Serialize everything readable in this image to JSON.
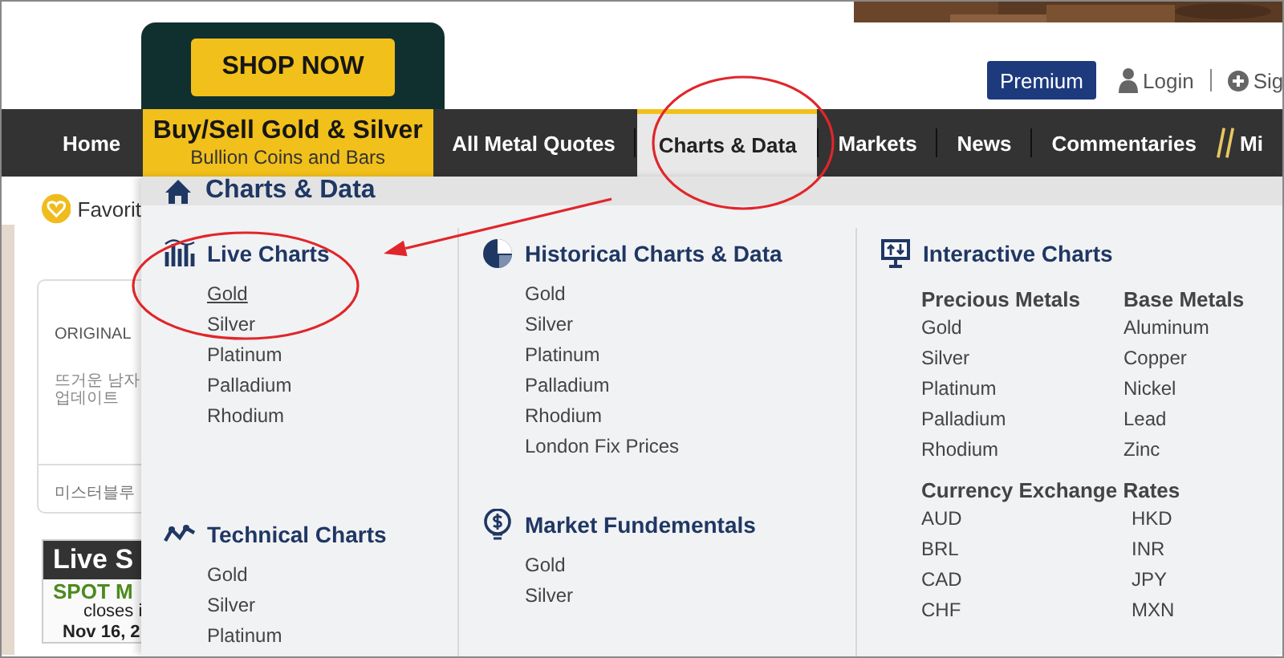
{
  "header": {
    "shop_button": "SHOP NOW",
    "premium_button": "Premium",
    "login_link": "Login",
    "signup_link": "Sig"
  },
  "nav": [
    {
      "label": "Home",
      "kind": "plain",
      "selected": false
    },
    {
      "label": "Buy/Sell Gold & Silver",
      "sublabel": "Bullion Coins and Bars",
      "kind": "promo",
      "selected": false
    },
    {
      "label": "All Metal Quotes",
      "kind": "plain",
      "selected": false
    },
    {
      "label": "Charts & Data",
      "kind": "plain",
      "selected": true
    },
    {
      "label": "Markets",
      "kind": "plain",
      "selected": false
    },
    {
      "label": "News",
      "kind": "plain",
      "selected": false
    },
    {
      "label": "Commentaries",
      "kind": "plain",
      "selected": false
    },
    {
      "label": "Mi",
      "kind": "featured",
      "selected": false
    }
  ],
  "page_behind": {
    "favorites_label": "Favorit",
    "card": {
      "lines": [
        "ORIGINAL",
        "뜨거운 남자",
        "업데이트"
      ],
      "footer": "미스터블루"
    },
    "live_box": {
      "title": "Live S",
      "spot_label": "SPOT M",
      "closes_text": "closes i",
      "date": "Nov 16, 2"
    }
  },
  "menu": {
    "title": "Charts & Data",
    "columns": [
      {
        "sections": [
          {
            "title": "Live Charts",
            "items": [
              {
                "label": "Gold",
                "hovered": true
              },
              {
                "label": "Silver",
                "hovered": false
              },
              {
                "label": "Platinum",
                "hovered": false
              },
              {
                "label": "Palladium",
                "hovered": false
              },
              {
                "label": "Rhodium",
                "hovered": false
              }
            ]
          },
          {
            "title": "Technical Charts",
            "items": [
              "Gold",
              "Silver",
              "Platinum"
            ]
          }
        ]
      },
      {
        "sections": [
          {
            "title": "Historical Charts & Data",
            "items": [
              "Gold",
              "Silver",
              "Platinum",
              "Palladium",
              "Rhodium",
              "London Fix Prices"
            ]
          },
          {
            "title": "Market Fundementals",
            "items": [
              "Gold",
              "Silver"
            ]
          }
        ]
      },
      {
        "sections": [
          {
            "title": "Interactive Charts",
            "groups": [
              {
                "heading": "Precious Metals",
                "items": [
                  "Gold",
                  "Silver",
                  "Platinum",
                  "Palladium",
                  "Rhodium"
                ]
              },
              {
                "heading": "Base Metals",
                "items": [
                  "Aluminum",
                  "Copper",
                  "Nickel",
                  "Lead",
                  "Zinc"
                ]
              }
            ],
            "currency": {
              "heading": "Currency Exchange Rates",
              "columns": [
                [
                  "AUD",
                  "BRL",
                  "CAD",
                  "CHF"
                ],
                [
                  "HKD",
                  "INR",
                  "JPY",
                  "MXN"
                ]
              ]
            }
          }
        ]
      }
    ]
  },
  "annotations": [
    {
      "kind": "ellipse"
    },
    {
      "kind": "ellipse"
    },
    {
      "kind": "arrow"
    }
  ]
}
